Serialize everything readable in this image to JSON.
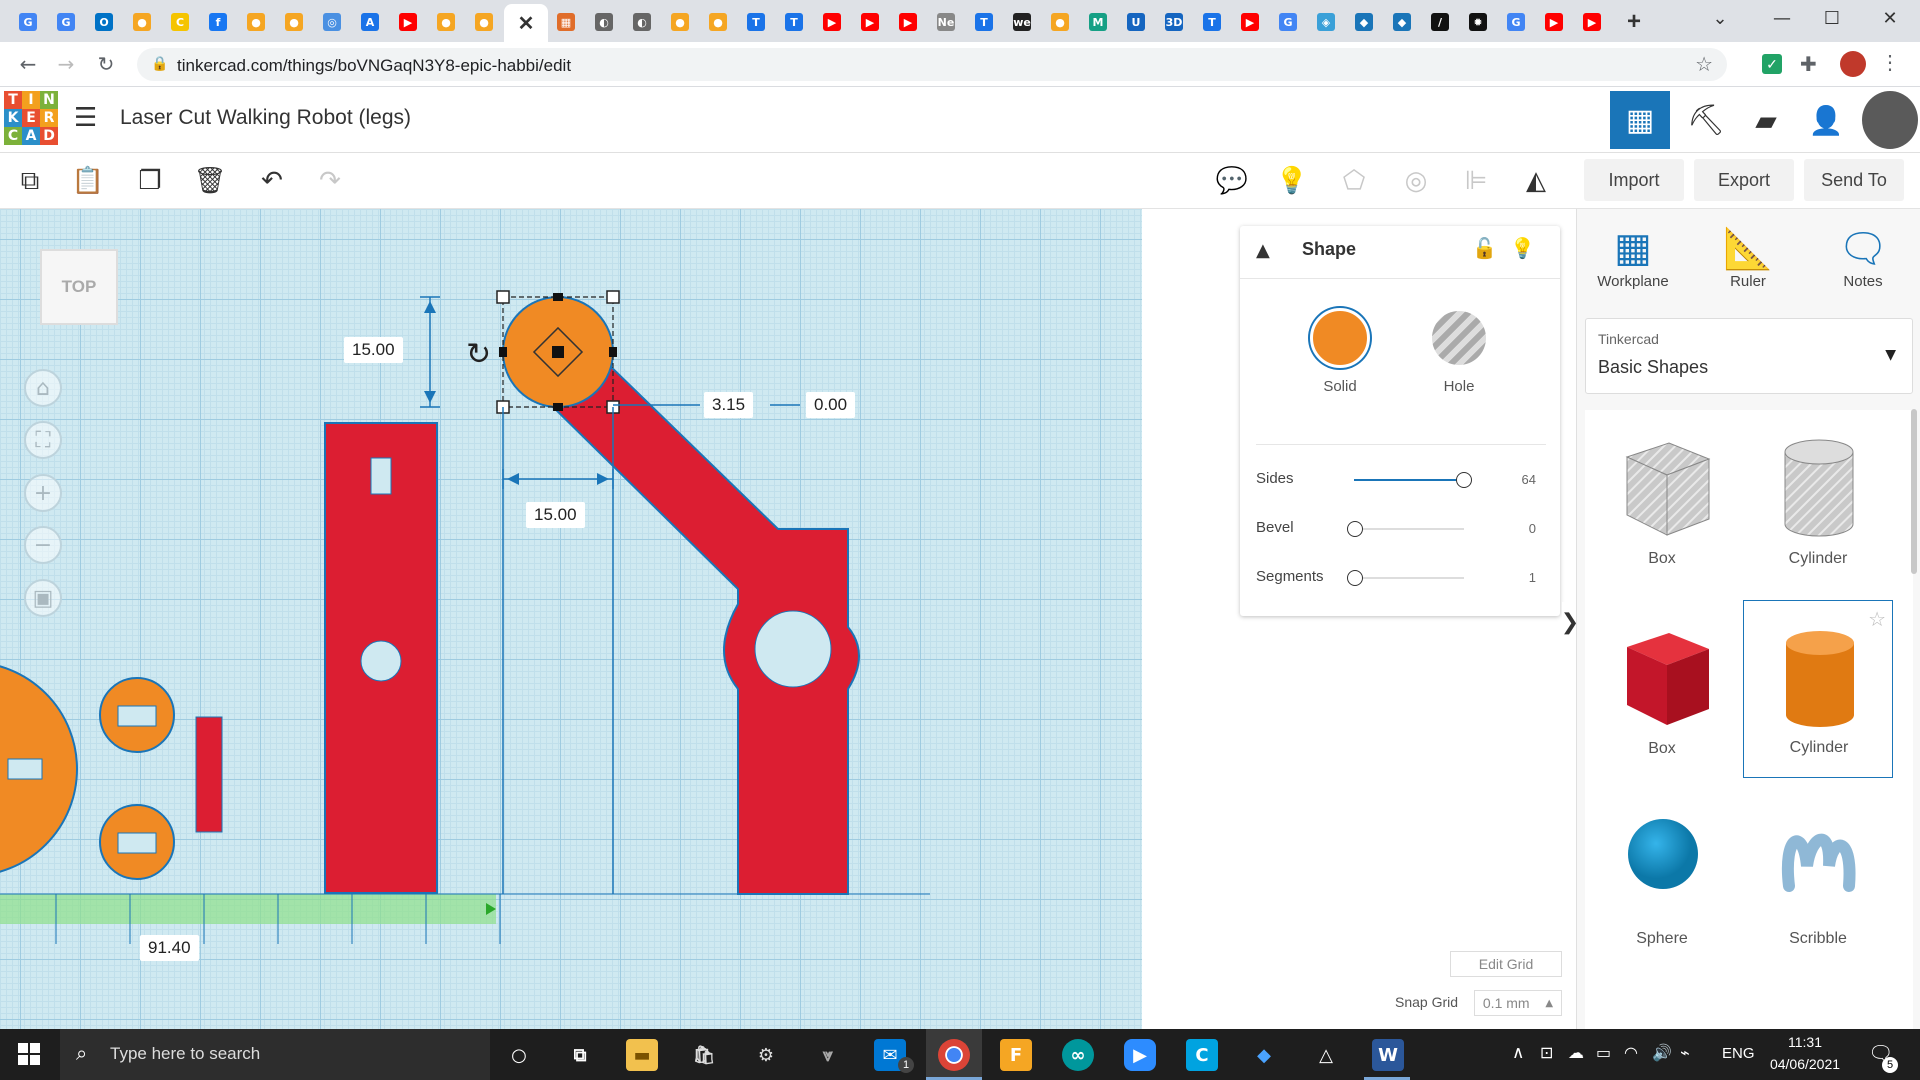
{
  "browser": {
    "url": "tinkercad.com/things/boVNGaqN3Y8-epic-habbi/edit",
    "tabs": [
      {
        "icon": "G",
        "color": "#4285f4"
      },
      {
        "icon": "G",
        "color": "#4285f4"
      },
      {
        "icon": "O",
        "color": "#0072c6"
      },
      {
        "icon": "●",
        "color": "#f5a623"
      },
      {
        "icon": "C",
        "color": "#f5c400"
      },
      {
        "icon": "f",
        "color": "#1877f2"
      },
      {
        "icon": "●",
        "color": "#f5a623"
      },
      {
        "icon": "●",
        "color": "#f5a623"
      },
      {
        "icon": "◎",
        "color": "#4a90e2"
      },
      {
        "icon": "A",
        "color": "#1a73e8"
      },
      {
        "icon": "▶",
        "color": "#ff0000"
      },
      {
        "icon": "●",
        "color": "#f5a623"
      },
      {
        "icon": "●",
        "color": "#f5a623"
      }
    ],
    "active_tab_close": "✕",
    "tabs_after": [
      {
        "icon": "▦",
        "color": "#e06d2a"
      },
      {
        "icon": "◐",
        "color": "#666666"
      },
      {
        "icon": "◐",
        "color": "#666666"
      },
      {
        "icon": "●",
        "color": "#f5a623"
      },
      {
        "icon": "●",
        "color": "#f5a623"
      },
      {
        "icon": "T",
        "color": "#1a73e8"
      },
      {
        "icon": "T",
        "color": "#1a73e8"
      },
      {
        "icon": "▶",
        "color": "#ff0000"
      },
      {
        "icon": "▶",
        "color": "#ff0000"
      },
      {
        "icon": "▶",
        "color": "#ff0000"
      },
      {
        "icon": "Ne",
        "color": "#888888"
      },
      {
        "icon": "T",
        "color": "#1a73e8"
      },
      {
        "icon": "we",
        "color": "#222222"
      },
      {
        "icon": "●",
        "color": "#f5a623"
      },
      {
        "icon": "M",
        "color": "#16a085"
      },
      {
        "icon": "U",
        "color": "#1565c0"
      },
      {
        "icon": "3D",
        "color": "#1565c0"
      },
      {
        "icon": "T",
        "color": "#1a73e8"
      },
      {
        "icon": "▶",
        "color": "#ff0000"
      },
      {
        "icon": "G",
        "color": "#4285f4"
      },
      {
        "icon": "◈",
        "color": "#3aa0d8"
      },
      {
        "icon": "◆",
        "color": "#1a75b8"
      },
      {
        "icon": "◆",
        "color": "#1a75b8"
      },
      {
        "icon": "/",
        "color": "#111111"
      },
      {
        "icon": "✹",
        "color": "#111111"
      },
      {
        "icon": "G",
        "color": "#4285f4"
      },
      {
        "icon": "▶",
        "color": "#ff0000"
      },
      {
        "icon": "▶",
        "color": "#ff0000"
      }
    ],
    "new_tab": "+"
  },
  "tinkercad": {
    "logo_letters": [
      "T",
      "I",
      "N",
      "K",
      "E",
      "R",
      "C",
      "A",
      "D"
    ],
    "logo_colors": [
      "#e84e31",
      "#f3a01e",
      "#7cb13a",
      "#2b8fc9",
      "#e84e31",
      "#f3a01e",
      "#7cb13a",
      "#2b8fc9",
      "#e84e31"
    ],
    "title": "Laser Cut Walking Robot (legs)",
    "toolbar": {
      "import": "Import",
      "export": "Export",
      "send_to": "Send To"
    },
    "viewcube": "TOP",
    "dims": {
      "height": "15.00",
      "width": "15.00",
      "x": "3.15",
      "y": "0.00",
      "ruler": "91.40"
    },
    "inspector": {
      "title": "Shape",
      "solid": "Solid",
      "hole": "Hole",
      "sides_label": "Sides",
      "sides_value": "64",
      "sides_fraction": 1.0,
      "bevel_label": "Bevel",
      "bevel_value": "0",
      "segments_label": "Segments",
      "segments_value": "1"
    },
    "panel": {
      "workplane": "Workplane",
      "ruler": "Ruler",
      "notes": "Notes",
      "lib_caption": "Tinkercad",
      "lib_name": "Basic Shapes",
      "shapes": [
        "Box",
        "Cylinder",
        "Box",
        "Cylinder",
        "Sphere",
        "Scribble"
      ]
    },
    "footer": {
      "edit_grid": "Edit Grid",
      "snap_grid_label": "Snap Grid",
      "snap_grid_value": "0.1 mm"
    },
    "colors": {
      "orange": "#f08a24",
      "red": "#dc1e32",
      "accent": "#1a75b8"
    }
  },
  "taskbar": {
    "search_placeholder": "Type here to search",
    "lang": "ENG",
    "time": "11:31",
    "date": "04/06/2021",
    "notif_count": "5",
    "mail_badge": "1"
  }
}
